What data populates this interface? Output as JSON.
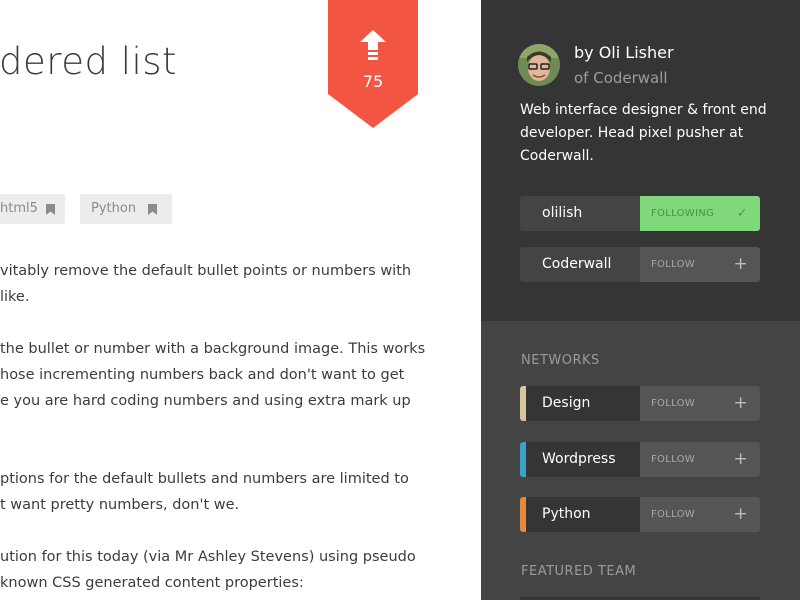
{
  "article": {
    "title": "rdered list",
    "upvotes": "75",
    "tags": [
      "html5",
      "Python"
    ],
    "paragraphs": [
      [
        "vitably remove the default bullet points or numbers with",
        "like."
      ],
      [
        "the bullet or number with a background image. This works",
        "hose incrementing numbers back and don't want to get",
        "e you are hard coding numbers and using extra mark up"
      ],
      [
        "ptions for the default bullets and numbers are limited to",
        "t want pretty numbers, don't we."
      ],
      [
        "ution for this today (via Mr Ashley Stevens) using pseudo",
        "known CSS generated content properties:"
      ]
    ]
  },
  "sidebar": {
    "author": {
      "name": "by Oli Lisher",
      "org": "of Coderwall",
      "bio": "Web interface designer & front end developer. Head pixel pusher at Coderwall."
    },
    "follows": [
      {
        "name": "olilish",
        "button": "FOLLOWING",
        "state": "following",
        "symbol": "check-icon"
      },
      {
        "name": "Coderwall",
        "button": "FOLLOW",
        "state": "not-following",
        "symbol": "plus-icon"
      }
    ],
    "networks_title": "NETWORKS",
    "networks": [
      {
        "name": "Design",
        "button": "FOLLOW",
        "color": "#d6c59e"
      },
      {
        "name": "Wordpress",
        "button": "FOLLOW",
        "color": "#3ba3c9"
      },
      {
        "name": "Python",
        "button": "FOLLOW",
        "color": "#e58b3a"
      }
    ],
    "featured_team_title": "FEATURED TEAM"
  },
  "colors": {
    "accent": "#f25541",
    "following_green": "#7fd97a",
    "sidebar_dark": "#353535",
    "sidebar_mid": "#444444"
  }
}
